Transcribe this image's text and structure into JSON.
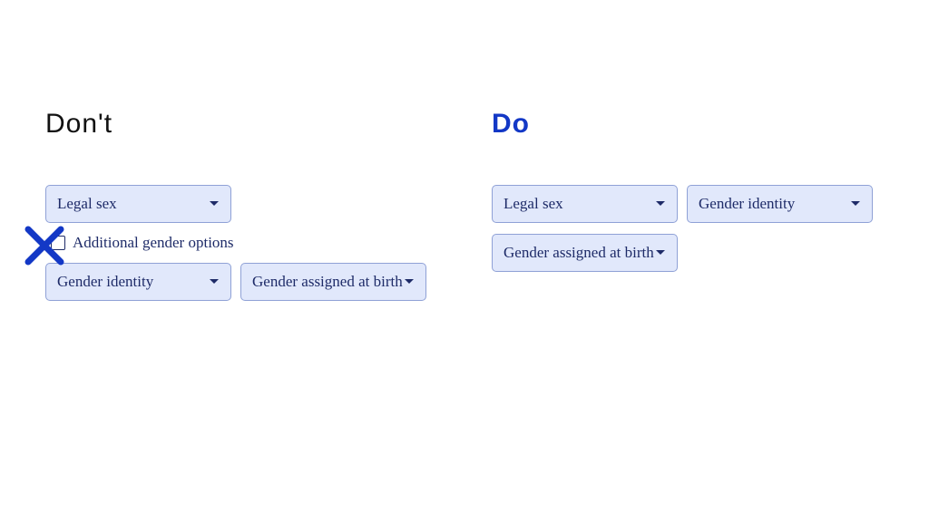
{
  "dont": {
    "heading": "Don't",
    "select1": {
      "label": "Legal sex"
    },
    "checkbox": {
      "label": "Additional gender options"
    },
    "select2": {
      "label": "Gender identity"
    },
    "select3": {
      "label": "Gender assigned at birth"
    }
  },
  "do": {
    "heading": "Do",
    "select1": {
      "label": "Legal sex"
    },
    "select2": {
      "label": "Gender identity"
    },
    "select3": {
      "label": "Gender assigned at birth"
    }
  },
  "colors": {
    "accent": "#1338c6",
    "selectFill": "#e1e8fb",
    "selectBorder": "#8fa1d6",
    "text": "#1e2b68"
  }
}
